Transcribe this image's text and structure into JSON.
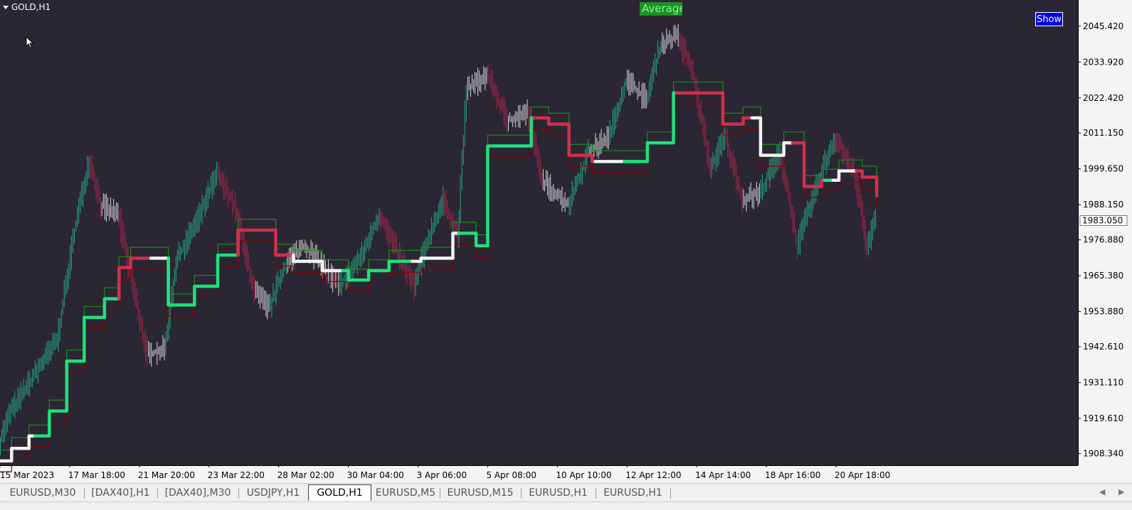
{
  "window": {
    "symbol_label": "GOLD,H1"
  },
  "overlay": {
    "average_label": "Average",
    "show_button": "Show"
  },
  "colors": {
    "background": "#2b2633",
    "axis_text": "#ffffff",
    "bull_bar": "#22a884",
    "bear_bar": "#a8274a",
    "neutral_bar": "#d8d8d8",
    "upper_band": "#1a8c1a",
    "lower_band": "#8b0000",
    "trend_up": "#1fe07a",
    "trend_down": "#d0304a",
    "trend_flat": "#f2f2f2",
    "current_price_bg": "#ffffff",
    "show_button_bg": "#0000e6",
    "average_label_bg": "#1f8f2a"
  },
  "chart_data": {
    "type": "bar",
    "title": "GOLD,H1",
    "y_axis": {
      "ticks": [
        2045.42,
        2033.92,
        2022.42,
        2011.15,
        1999.65,
        1988.15,
        1976.88,
        1965.38,
        1953.88,
        1942.61,
        1931.11,
        1919.61,
        1908.34
      ],
      "tick_labels": [
        "2045.420",
        "2033.920",
        "2022.420",
        "2011.150",
        "1999.650",
        "1988.150",
        "1976.880",
        "1965.380",
        "1953.880",
        "1942.610",
        "1931.110",
        "1919.610",
        "1908.340"
      ],
      "ylim": [
        1904.6,
        2053.8
      ],
      "current_price": 1983.05,
      "current_price_label": "1983.050"
    },
    "x_axis": {
      "tick_labels": [
        "15 Mar 2023",
        "17 Mar 18:00",
        "21 Mar 20:00",
        "23 Mar 22:00",
        "28 Mar 02:00",
        "30 Mar 04:00",
        "3 Apr 06:00",
        "5 Apr 08:00",
        "10 Apr 10:00",
        "12 Apr 12:00",
        "14 Apr 14:00",
        "18 Apr 16:00",
        "20 Apr 18:00"
      ],
      "tick_positions": [
        0,
        48,
        96,
        144,
        192,
        240,
        288,
        336,
        384,
        432,
        480,
        528,
        576
      ],
      "bar_count": 604
    },
    "price_path": [
      [
        0,
        1912
      ],
      [
        8,
        1922
      ],
      [
        22,
        1932
      ],
      [
        40,
        1945
      ],
      [
        52,
        1980
      ],
      [
        62,
        2003
      ],
      [
        70,
        1988
      ],
      [
        82,
        1985
      ],
      [
        92,
        1962
      ],
      [
        102,
        1940
      ],
      [
        114,
        1942
      ],
      [
        122,
        1970
      ],
      [
        138,
        1985
      ],
      [
        150,
        1998
      ],
      [
        162,
        1988
      ],
      [
        176,
        1960
      ],
      [
        186,
        1955
      ],
      [
        198,
        1970
      ],
      [
        210,
        1975
      ],
      [
        224,
        1968
      ],
      [
        234,
        1962
      ],
      [
        250,
        1972
      ],
      [
        262,
        1985
      ],
      [
        272,
        1975
      ],
      [
        286,
        1962
      ],
      [
        296,
        1978
      ],
      [
        306,
        1990
      ],
      [
        316,
        1978
      ],
      [
        322,
        2025
      ],
      [
        336,
        2030
      ],
      [
        350,
        2015
      ],
      [
        364,
        2018
      ],
      [
        374,
        1996
      ],
      [
        392,
        1988
      ],
      [
        406,
        2005
      ],
      [
        420,
        2010
      ],
      [
        432,
        2028
      ],
      [
        446,
        2022
      ],
      [
        456,
        2040
      ],
      [
        468,
        2042
      ],
      [
        478,
        2030
      ],
      [
        490,
        2000
      ],
      [
        500,
        2010
      ],
      [
        512,
        1990
      ],
      [
        524,
        1992
      ],
      [
        538,
        2005
      ],
      [
        550,
        1975
      ],
      [
        566,
        1998
      ],
      [
        576,
        2010
      ],
      [
        590,
        1997
      ],
      [
        598,
        1975
      ],
      [
        604,
        1984
      ]
    ],
    "trend_line": [
      [
        0,
        1906
      ],
      [
        8,
        1910
      ],
      [
        20,
        1914
      ],
      [
        34,
        1922
      ],
      [
        46,
        1938
      ],
      [
        58,
        1952
      ],
      [
        72,
        1958
      ],
      [
        82,
        1968
      ],
      [
        90,
        1971
      ],
      [
        104,
        1971
      ],
      [
        116,
        1956
      ],
      [
        134,
        1962
      ],
      [
        150,
        1972
      ],
      [
        164,
        1980
      ],
      [
        178,
        1980
      ],
      [
        190,
        1972
      ],
      [
        202,
        1970
      ],
      [
        222,
        1967
      ],
      [
        240,
        1964
      ],
      [
        254,
        1967
      ],
      [
        268,
        1970
      ],
      [
        290,
        1971
      ],
      [
        312,
        1979
      ],
      [
        328,
        1975
      ],
      [
        336,
        2007
      ],
      [
        348,
        2007
      ],
      [
        366,
        2016
      ],
      [
        378,
        2014
      ],
      [
        392,
        2004
      ],
      [
        408,
        2002
      ],
      [
        426,
        2002
      ],
      [
        446,
        2008
      ],
      [
        464,
        2024
      ],
      [
        478,
        2024
      ],
      [
        498,
        2014
      ],
      [
        512,
        2016
      ],
      [
        524,
        2004
      ],
      [
        532,
        2004
      ],
      [
        540,
        2008
      ],
      [
        554,
        1994
      ],
      [
        566,
        1996
      ],
      [
        578,
        1999
      ],
      [
        594,
        1997
      ],
      [
        604,
        1991
      ]
    ],
    "trend_segments": [
      {
        "from": 0,
        "to": 24,
        "state": "flat"
      },
      {
        "from": 24,
        "to": 82,
        "state": "up"
      },
      {
        "from": 82,
        "to": 104,
        "state": "down"
      },
      {
        "from": 104,
        "to": 116,
        "state": "flat"
      },
      {
        "from": 116,
        "to": 164,
        "state": "up"
      },
      {
        "from": 164,
        "to": 202,
        "state": "down"
      },
      {
        "from": 202,
        "to": 236,
        "state": "flat"
      },
      {
        "from": 236,
        "to": 284,
        "state": "up"
      },
      {
        "from": 284,
        "to": 316,
        "state": "flat"
      },
      {
        "from": 316,
        "to": 368,
        "state": "up"
      },
      {
        "from": 368,
        "to": 410,
        "state": "down"
      },
      {
        "from": 410,
        "to": 430,
        "state": "flat"
      },
      {
        "from": 430,
        "to": 466,
        "state": "up"
      },
      {
        "from": 466,
        "to": 518,
        "state": "down"
      },
      {
        "from": 518,
        "to": 546,
        "state": "flat"
      },
      {
        "from": 546,
        "to": 568,
        "state": "down"
      },
      {
        "from": 568,
        "to": 574,
        "state": "up"
      },
      {
        "from": 574,
        "to": 590,
        "state": "flat"
      },
      {
        "from": 590,
        "to": 604,
        "state": "down"
      }
    ],
    "band_offset": 3.5,
    "grid": false,
    "legend": "none"
  },
  "tabs": [
    {
      "label": "EURUSD,M30",
      "active": false
    },
    {
      "label": "[DAX40],H1",
      "active": false
    },
    {
      "label": "[DAX40],M30",
      "active": false
    },
    {
      "label": "USDJPY,H1",
      "active": false
    },
    {
      "label": "GOLD,H1",
      "active": true
    },
    {
      "label": "EURUSD,M5",
      "active": false
    },
    {
      "label": "EURUSD,M15",
      "active": false
    },
    {
      "label": "EURUSD,H1",
      "active": false
    },
    {
      "label": "EURUSD,H1",
      "active": false
    }
  ],
  "tab_nav": {
    "left_icon": "caret-left-icon",
    "right_icon": "caret-right-icon"
  }
}
